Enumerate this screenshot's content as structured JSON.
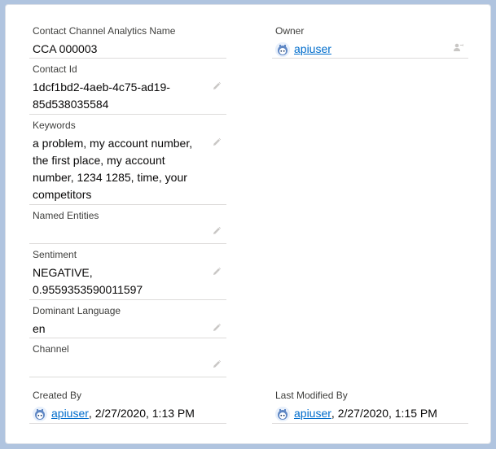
{
  "fields": {
    "name": {
      "label": "Contact Channel Analytics Name",
      "value": "CCA 000003"
    },
    "contact_id": {
      "label": "Contact Id",
      "value_line1": "1dcf1bd2-4aeb-4c75-ad19-",
      "value_line2": "85d538035584"
    },
    "keywords": {
      "label": "Keywords",
      "lines": [
        "a problem, my account number,",
        "the first place, my account",
        "number, 1234 1285, time, your",
        "competitors"
      ]
    },
    "named_entities": {
      "label": "Named Entities",
      "value": ""
    },
    "sentiment": {
      "label": "Sentiment",
      "value_line1": "NEGATIVE,",
      "value_line2": "0.9559353590011597"
    },
    "dominant_language": {
      "label": "Dominant Language",
      "value": "en"
    },
    "channel": {
      "label": "Channel",
      "value": ""
    },
    "owner": {
      "label": "Owner",
      "user": "apiuser"
    },
    "created_by": {
      "label": "Created By",
      "user": "apiuser",
      "timestamp": ", 2/27/2020, 1:13 PM"
    },
    "last_modified_by": {
      "label": "Last Modified By",
      "user": "apiuser",
      "timestamp": ", 2/27/2020, 1:15 PM"
    }
  },
  "icons": {
    "edit": "pencil-icon",
    "change_owner": "change-owner-icon",
    "avatar": "user-avatar-icon"
  },
  "colors": {
    "background": "#b0c4df",
    "link": "#006dcc",
    "divider": "#dddbda"
  }
}
